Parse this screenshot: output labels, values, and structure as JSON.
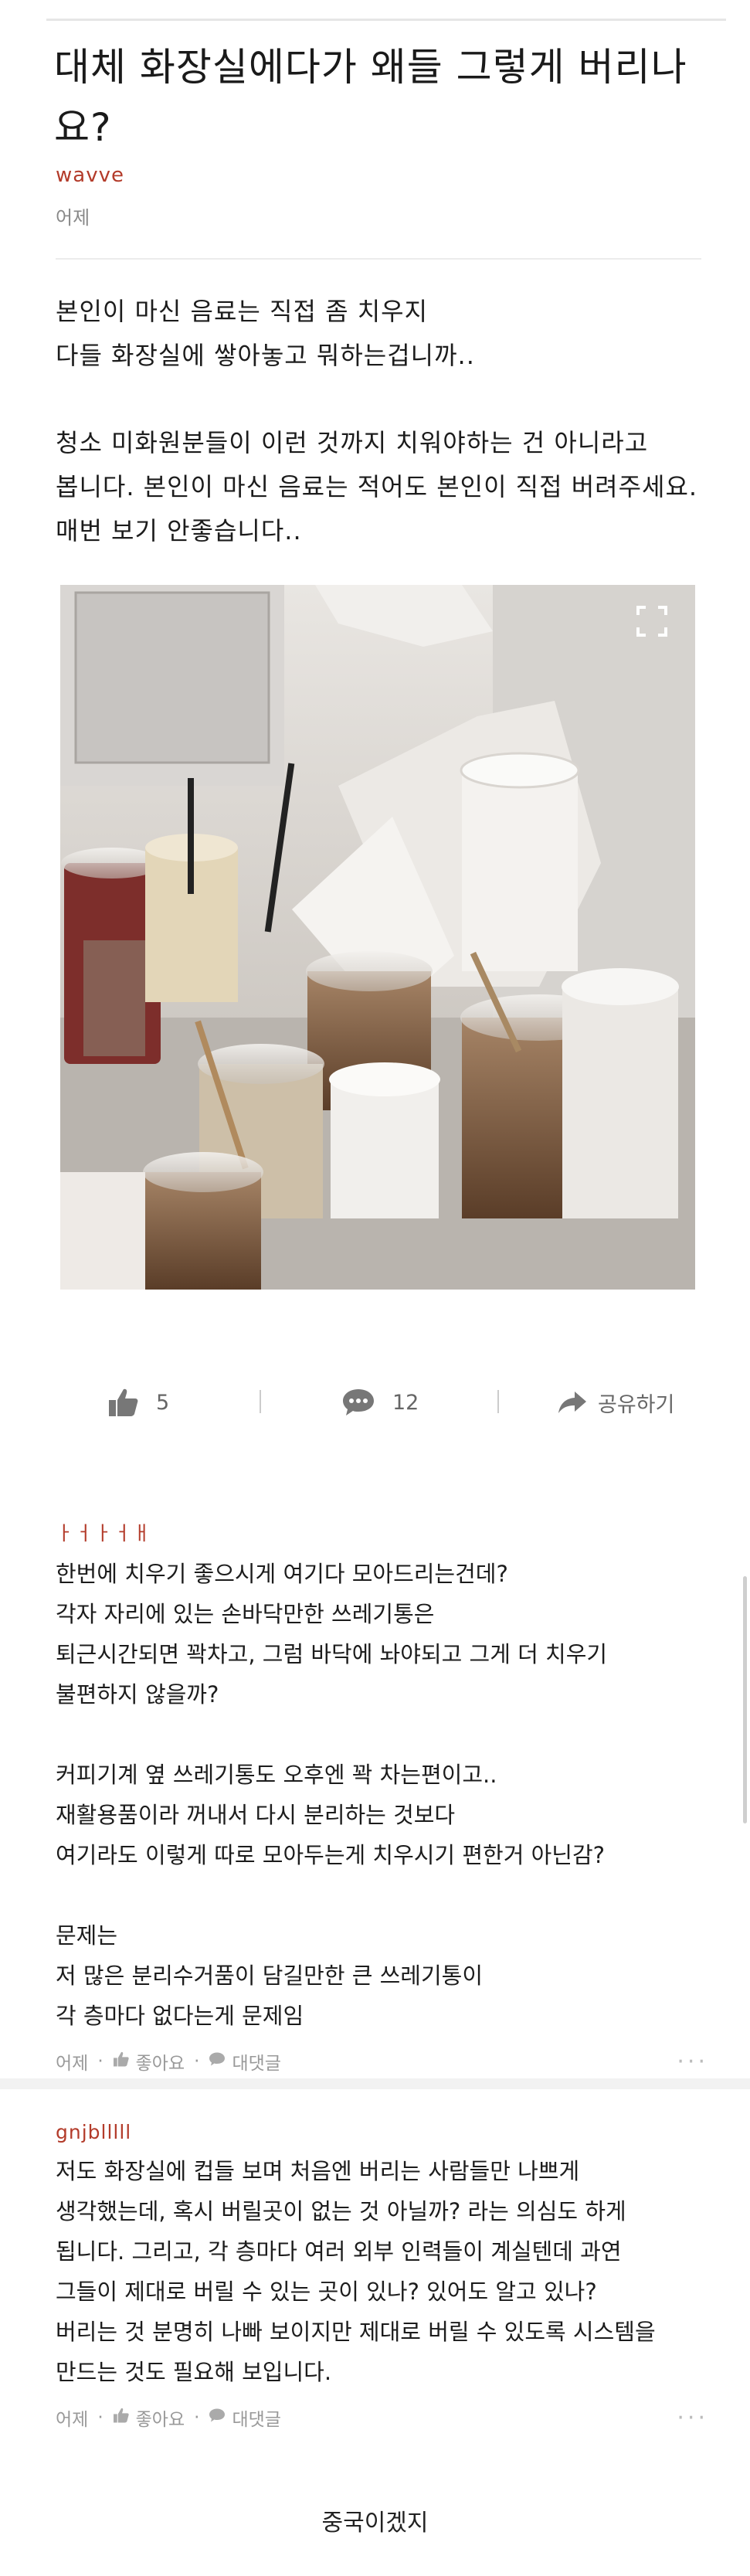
{
  "post": {
    "title": "대체 화장실에다가 왜들 그렇게 버리나요?",
    "author": "wavve",
    "date": "어제",
    "body": [
      "본인이 마신 음료는 직접 좀 치우지",
      "다들 화장실에 쌓아놓고 뭐하는겁니까..",
      "",
      "청소 미화원분들이 이런 것까지 치워야하는 건 아니라고",
      "봅니다. 본인이 마신 음료는 적어도 본인이 직접 버려주세요.",
      "매번 보기 안좋습니다.."
    ]
  },
  "actions": {
    "like_count": "5",
    "comment_count": "12",
    "share_label": "공유하기"
  },
  "comments": [
    {
      "user": "ㅏㅓㅏㅓㅐ",
      "lines": [
        "한번에 치우기 좋으시게 여기다 모아드리는건데?",
        "각자 자리에 있는 손바닥만한 쓰레기통은",
        "퇴근시간되면 꽉차고, 그럼 바닥에 놔야되고 그게 더 치우기",
        "불편하지 않을까?",
        "",
        "커피기계 옆 쓰레기통도 오후엔 꽉 차는편이고..",
        "재활용품이라 꺼내서 다시 분리하는 것보다",
        "여기라도 이렇게 따로 모아두는게 치우시기 편한거 아닌감?",
        "",
        "문제는",
        "저 많은 분리수거품이 담길만한 큰 쓰레기통이",
        " 각 층마다 없다는게 문제임"
      ],
      "date": "어제",
      "like_label": "좋아요",
      "reply_label": "대댓글"
    },
    {
      "user": "gnjblllll",
      "lines": [
        "저도 화장실에 컵들 보며 처음엔 버리는 사람들만 나쁘게",
        "생각했는데, 혹시 버릴곳이 없는 것 아닐까? 라는 의심도 하게",
        "됩니다. 그리고, 각 층마다 여러 외부 인력들이 계실텐데 과연",
        "그들이 제대로 버릴 수 있는 곳이 있나? 있어도 알고 있나?",
        "버리는 것 분명히 나빠 보이지만 제대로 버릴 수 있도록 시스템을",
        "만드는 것도 필요해 보입니다."
      ],
      "date": "어제",
      "like_label": "좋아요",
      "reply_label": "대댓글"
    }
  ],
  "caption": "중국이겠지",
  "icons": {
    "like": "thumbs-up-icon",
    "comment": "speech-bubble-icon",
    "share": "share-arrow-icon",
    "expand": "fullscreen-icon",
    "more": "more-dots-icon"
  },
  "colors": {
    "author": "#b33b2a",
    "meta": "#999999"
  }
}
